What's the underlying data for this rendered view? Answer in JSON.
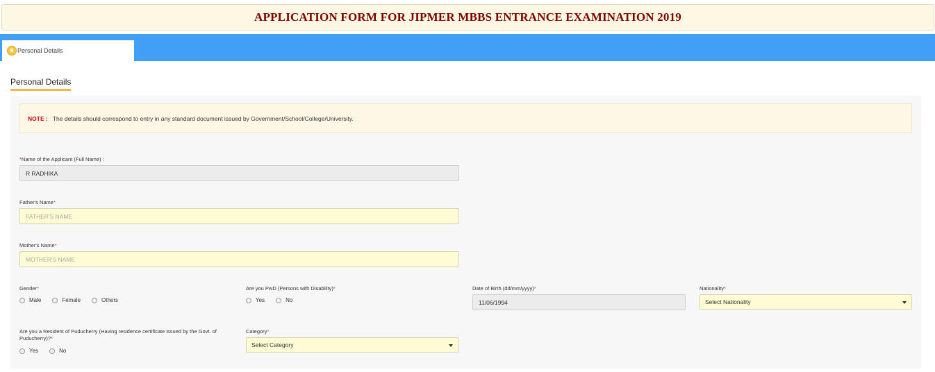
{
  "header": {
    "title": "APPLICATION FORM FOR JIPMER MBBS ENTRANCE EXAMINATION 2019"
  },
  "tabs": [
    {
      "label": "Personal Details",
      "icon": "personal-details-icon"
    }
  ],
  "section": {
    "heading": "Personal Details"
  },
  "note": {
    "label": "NOTE :",
    "text": "The details should correspond to entry in any standard document issued by Government/School/College/University."
  },
  "form": {
    "applicant_name": {
      "label": "Name of the Applicant (Full Name) :",
      "value": "R RADHIKA"
    },
    "father_name": {
      "label": "Father's Name",
      "placeholder": "FATHER'S NAME"
    },
    "mother_name": {
      "label": "Mother's Name",
      "placeholder": "MOTHER'S NAME"
    },
    "gender": {
      "label": "Gender",
      "options": [
        "Male",
        "Female",
        "Others"
      ]
    },
    "pwd": {
      "label": "Are you PwD (Persons with Disability)",
      "options": [
        "Yes",
        "No"
      ]
    },
    "dob": {
      "label": "Date of Birth (dd/mm/yyyy)",
      "value": "11/06/1994"
    },
    "nationality": {
      "label": "Nationality",
      "selected": "Select Nationality"
    },
    "resident": {
      "label": "Are you a Resident of Puducherry (Having residence certificate issued by the Govt. of Puducherry)?",
      "options": [
        "Yes",
        "No"
      ]
    },
    "category": {
      "label": "Category",
      "selected": "Select Category"
    },
    "required_mark": "*"
  },
  "colors": {
    "tab_strip": "#42a0f4",
    "title_text": "#800000",
    "editable_field": "#fefcd4",
    "accent_underline": "#f4b942",
    "note_label": "#d0021b"
  }
}
